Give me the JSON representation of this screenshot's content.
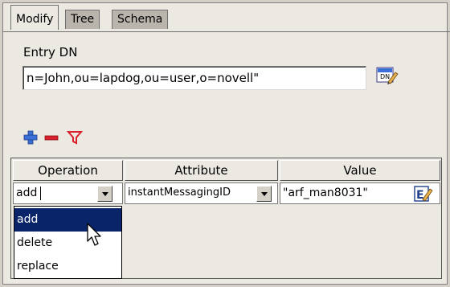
{
  "tabs": [
    {
      "label": "Modify",
      "active": true
    },
    {
      "label": "Tree",
      "active": false
    },
    {
      "label": "Schema",
      "active": false
    }
  ],
  "entry_dn": {
    "label": "Entry DN",
    "value": "n=John,ou=lapdog,ou=user,o=novell\""
  },
  "toolbar": {
    "icons": [
      "add-icon",
      "remove-icon",
      "filter-icon"
    ],
    "colors": {
      "add": "#3a6fd8",
      "remove": "#d81f2a",
      "filter": "#d81f2a"
    }
  },
  "table": {
    "columns": [
      "Operation",
      "Attribute",
      "Value"
    ],
    "row": {
      "operation": "add",
      "attribute": "instantMessagingID",
      "value": "\"arf_man8031\""
    }
  },
  "operation_dropdown": {
    "options": [
      "add",
      "delete",
      "replace"
    ],
    "highlighted": "add"
  },
  "colors": {
    "selection": "#0a246a",
    "panel": "#ece9e3"
  }
}
